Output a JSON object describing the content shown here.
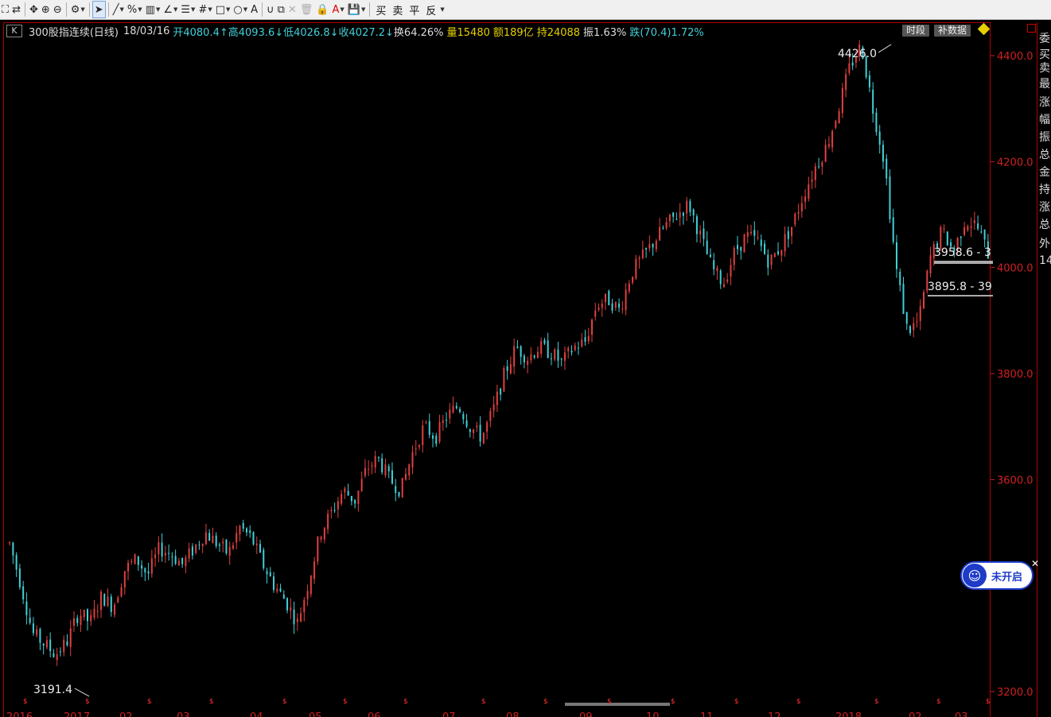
{
  "toolbar": {
    "icons": [
      "zoom-icon",
      "refresh-icon",
      "move-icon",
      "zoom-in-icon",
      "zoom-out-icon",
      "settings-icon",
      "cursor-icon",
      "line-icon",
      "percent-icon",
      "grid-icon",
      "angle-icon",
      "list-icon",
      "hash-icon",
      "rect-icon",
      "circle-icon",
      "text-icon",
      "magnet-icon",
      "copy-icon",
      "delete-icon",
      "trash-icon",
      "lock-icon",
      "color-icon",
      "save-icon"
    ],
    "buy_label": "买",
    "sell_label": "卖",
    "flat_label": "平",
    "reverse_label": "反"
  },
  "info": {
    "k_label": "K",
    "name": "300股指连续(日线)",
    "date": "18/03/16",
    "open": "开4080.4↑",
    "high": "高4093.6↓",
    "low": "低4026.8↓",
    "close": "收4027.2↓",
    "turnover": "换64.26%",
    "volume": "量15480",
    "amount": "额189亿",
    "position": "持24088",
    "amplitude": "振1.63%",
    "change": "跌(70.4)1.72%"
  },
  "buttons": {
    "period": "时段",
    "supplement": "补数据"
  },
  "right_panel_chars": [
    "委",
    "买",
    "卖",
    "最",
    "涨",
    "幅",
    "振",
    "总",
    "金",
    "持",
    "涨",
    "总",
    "外",
    "14"
  ],
  "badge": {
    "label": "未开启"
  },
  "colors": {
    "up": "#e04040",
    "down": "#40d0d8",
    "axis": "#d02020",
    "frame": "#b00000"
  },
  "chart_data": {
    "type": "candlestick",
    "ylim": [
      3160,
      4440
    ],
    "y_ticks": [
      4400.0,
      4200.0,
      4000.0,
      3800.0,
      3600.0,
      3200.0
    ],
    "x_labels": [
      "2016",
      "2017",
      "02",
      "03",
      "04",
      "05",
      "06",
      "07",
      "08",
      "09",
      "10",
      "11",
      "12",
      "2018",
      "02",
      "03"
    ],
    "annotations": [
      {
        "text": "4426.0",
        "x": "2018-01-24",
        "y": 4426.0
      },
      {
        "text": "3191.4",
        "x": "2016-12-29",
        "y": 3191.4
      },
      {
        "text": "3958.6 - 3",
        "y": 3958.6
      },
      {
        "text": "3895.8 - 39",
        "y": 3895.8
      }
    ],
    "summary_closes": [
      3480,
      3400,
      3310,
      3290,
      3270,
      3295,
      3350,
      3330,
      3380,
      3360,
      3430,
      3450,
      3420,
      3470,
      3460,
      3440,
      3470,
      3500,
      3480,
      3460,
      3510,
      3490,
      3440,
      3400,
      3370,
      3330,
      3410,
      3500,
      3540,
      3580,
      3560,
      3620,
      3640,
      3600,
      3580,
      3650,
      3700,
      3680,
      3720,
      3740,
      3700,
      3680,
      3730,
      3800,
      3850,
      3830,
      3850,
      3840,
      3820,
      3850,
      3860,
      3930,
      3940,
      3920,
      3990,
      4020,
      4050,
      4080,
      4100,
      4120,
      4060,
      4000,
      3970,
      4030,
      4060,
      4050,
      4010,
      4040,
      4080,
      4140,
      4190,
      4230,
      4300,
      4380,
      4420,
      4300,
      4200,
      4000,
      3880,
      3900,
      4020,
      4070,
      4030,
      4090,
      4080,
      4027
    ]
  }
}
